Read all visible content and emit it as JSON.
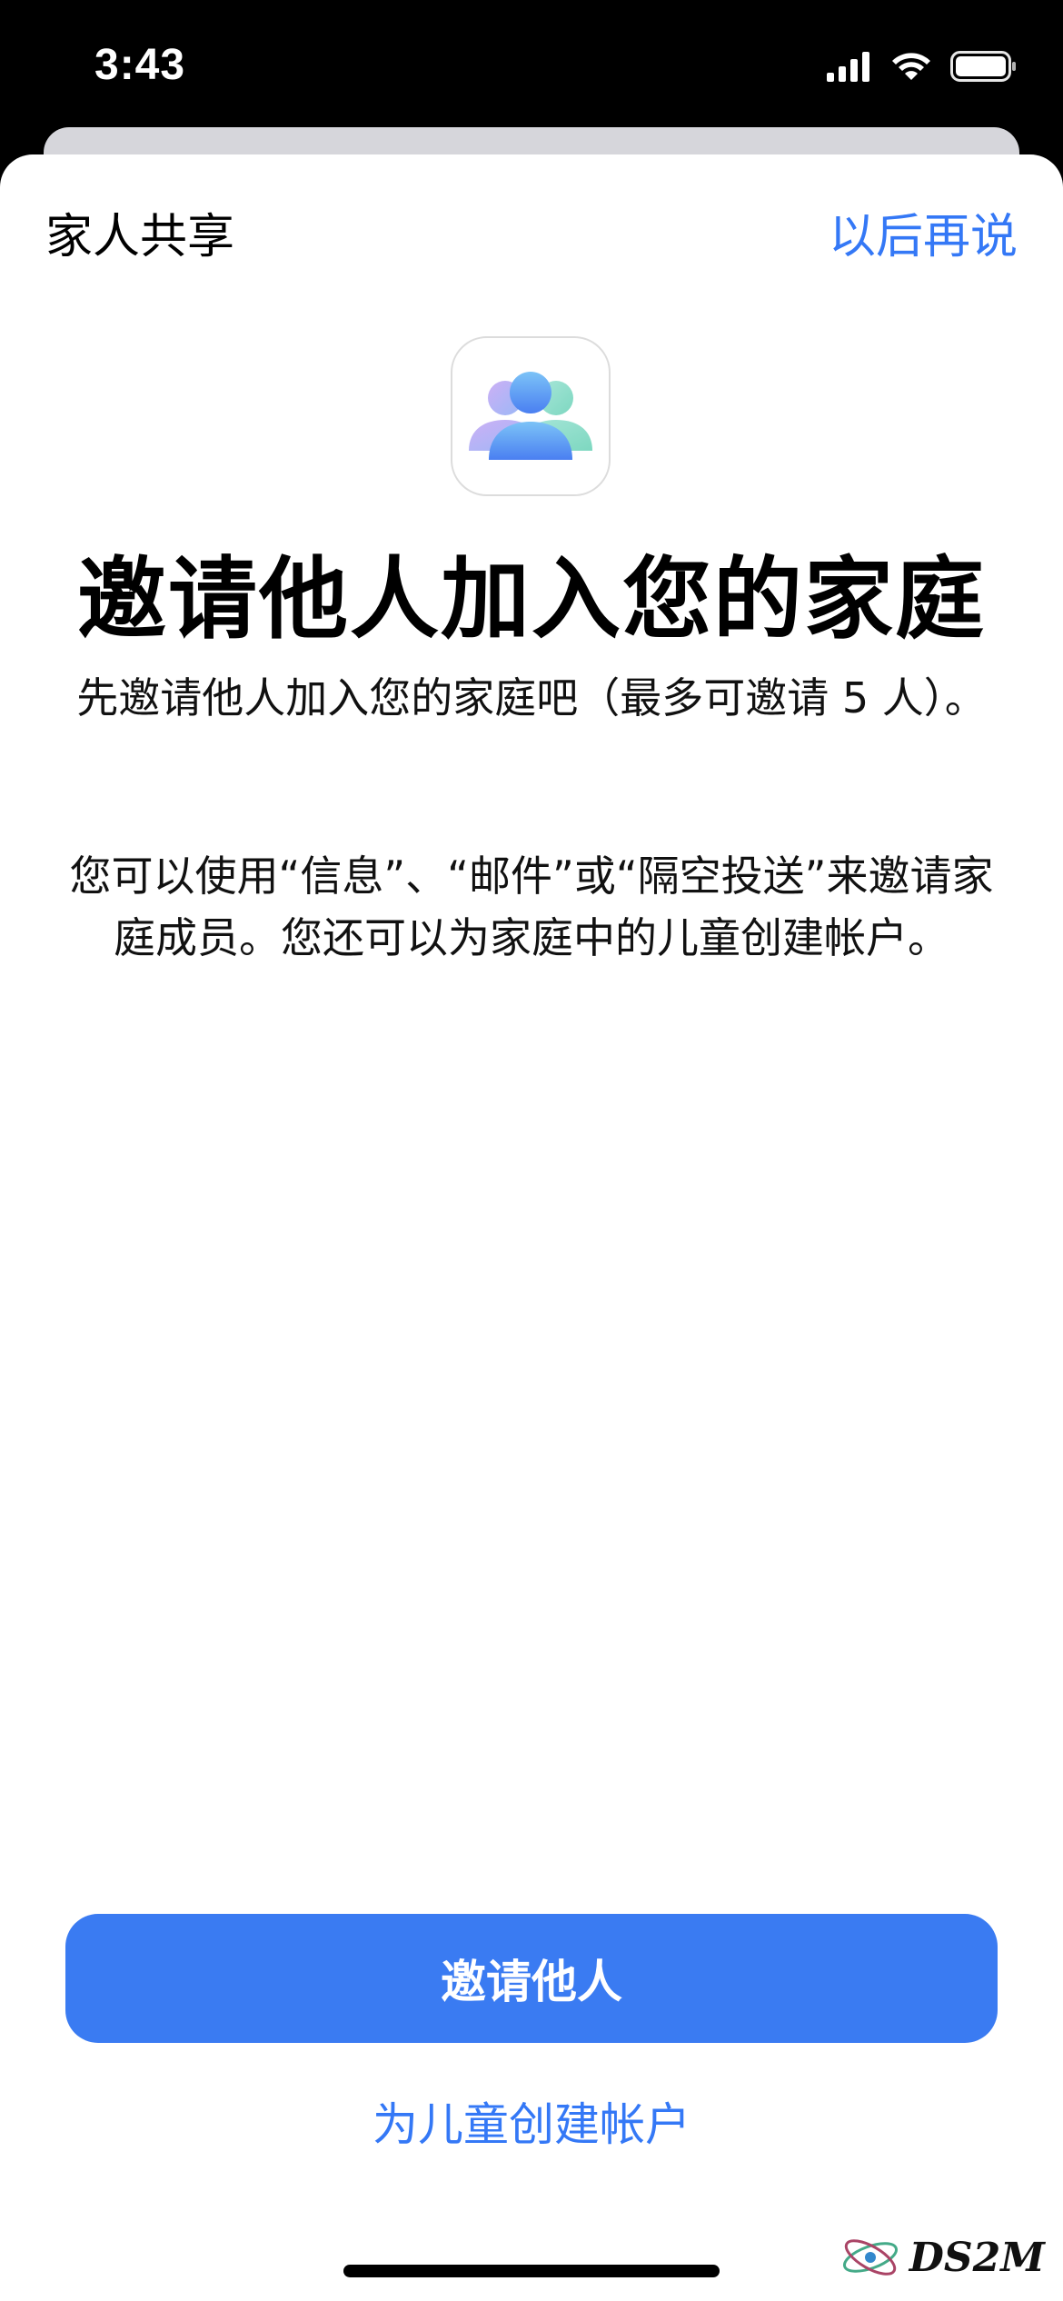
{
  "status_bar": {
    "time": "3:43",
    "icons": [
      "cellular-signal-icon",
      "wifi-icon",
      "battery-icon"
    ]
  },
  "nav": {
    "title": "家人共享",
    "later": "以后再说"
  },
  "app_icon": "family-sharing-icon",
  "main": {
    "title": "邀请他人加入您的家庭",
    "subtitle": "先邀请他人加入您的家庭吧（最多可邀请 5 人）。",
    "description": "您可以使用“信息”、“邮件”或“隔空投送”来邀请家庭成员。您还可以为家庭中的儿童创建帐户。"
  },
  "actions": {
    "invite_button": "邀请他人",
    "child_account_link": "为儿童创建帐户"
  },
  "watermark": {
    "text": "DS2M"
  },
  "colors": {
    "accent": "#3478f6",
    "button": "#3a7bf2"
  }
}
